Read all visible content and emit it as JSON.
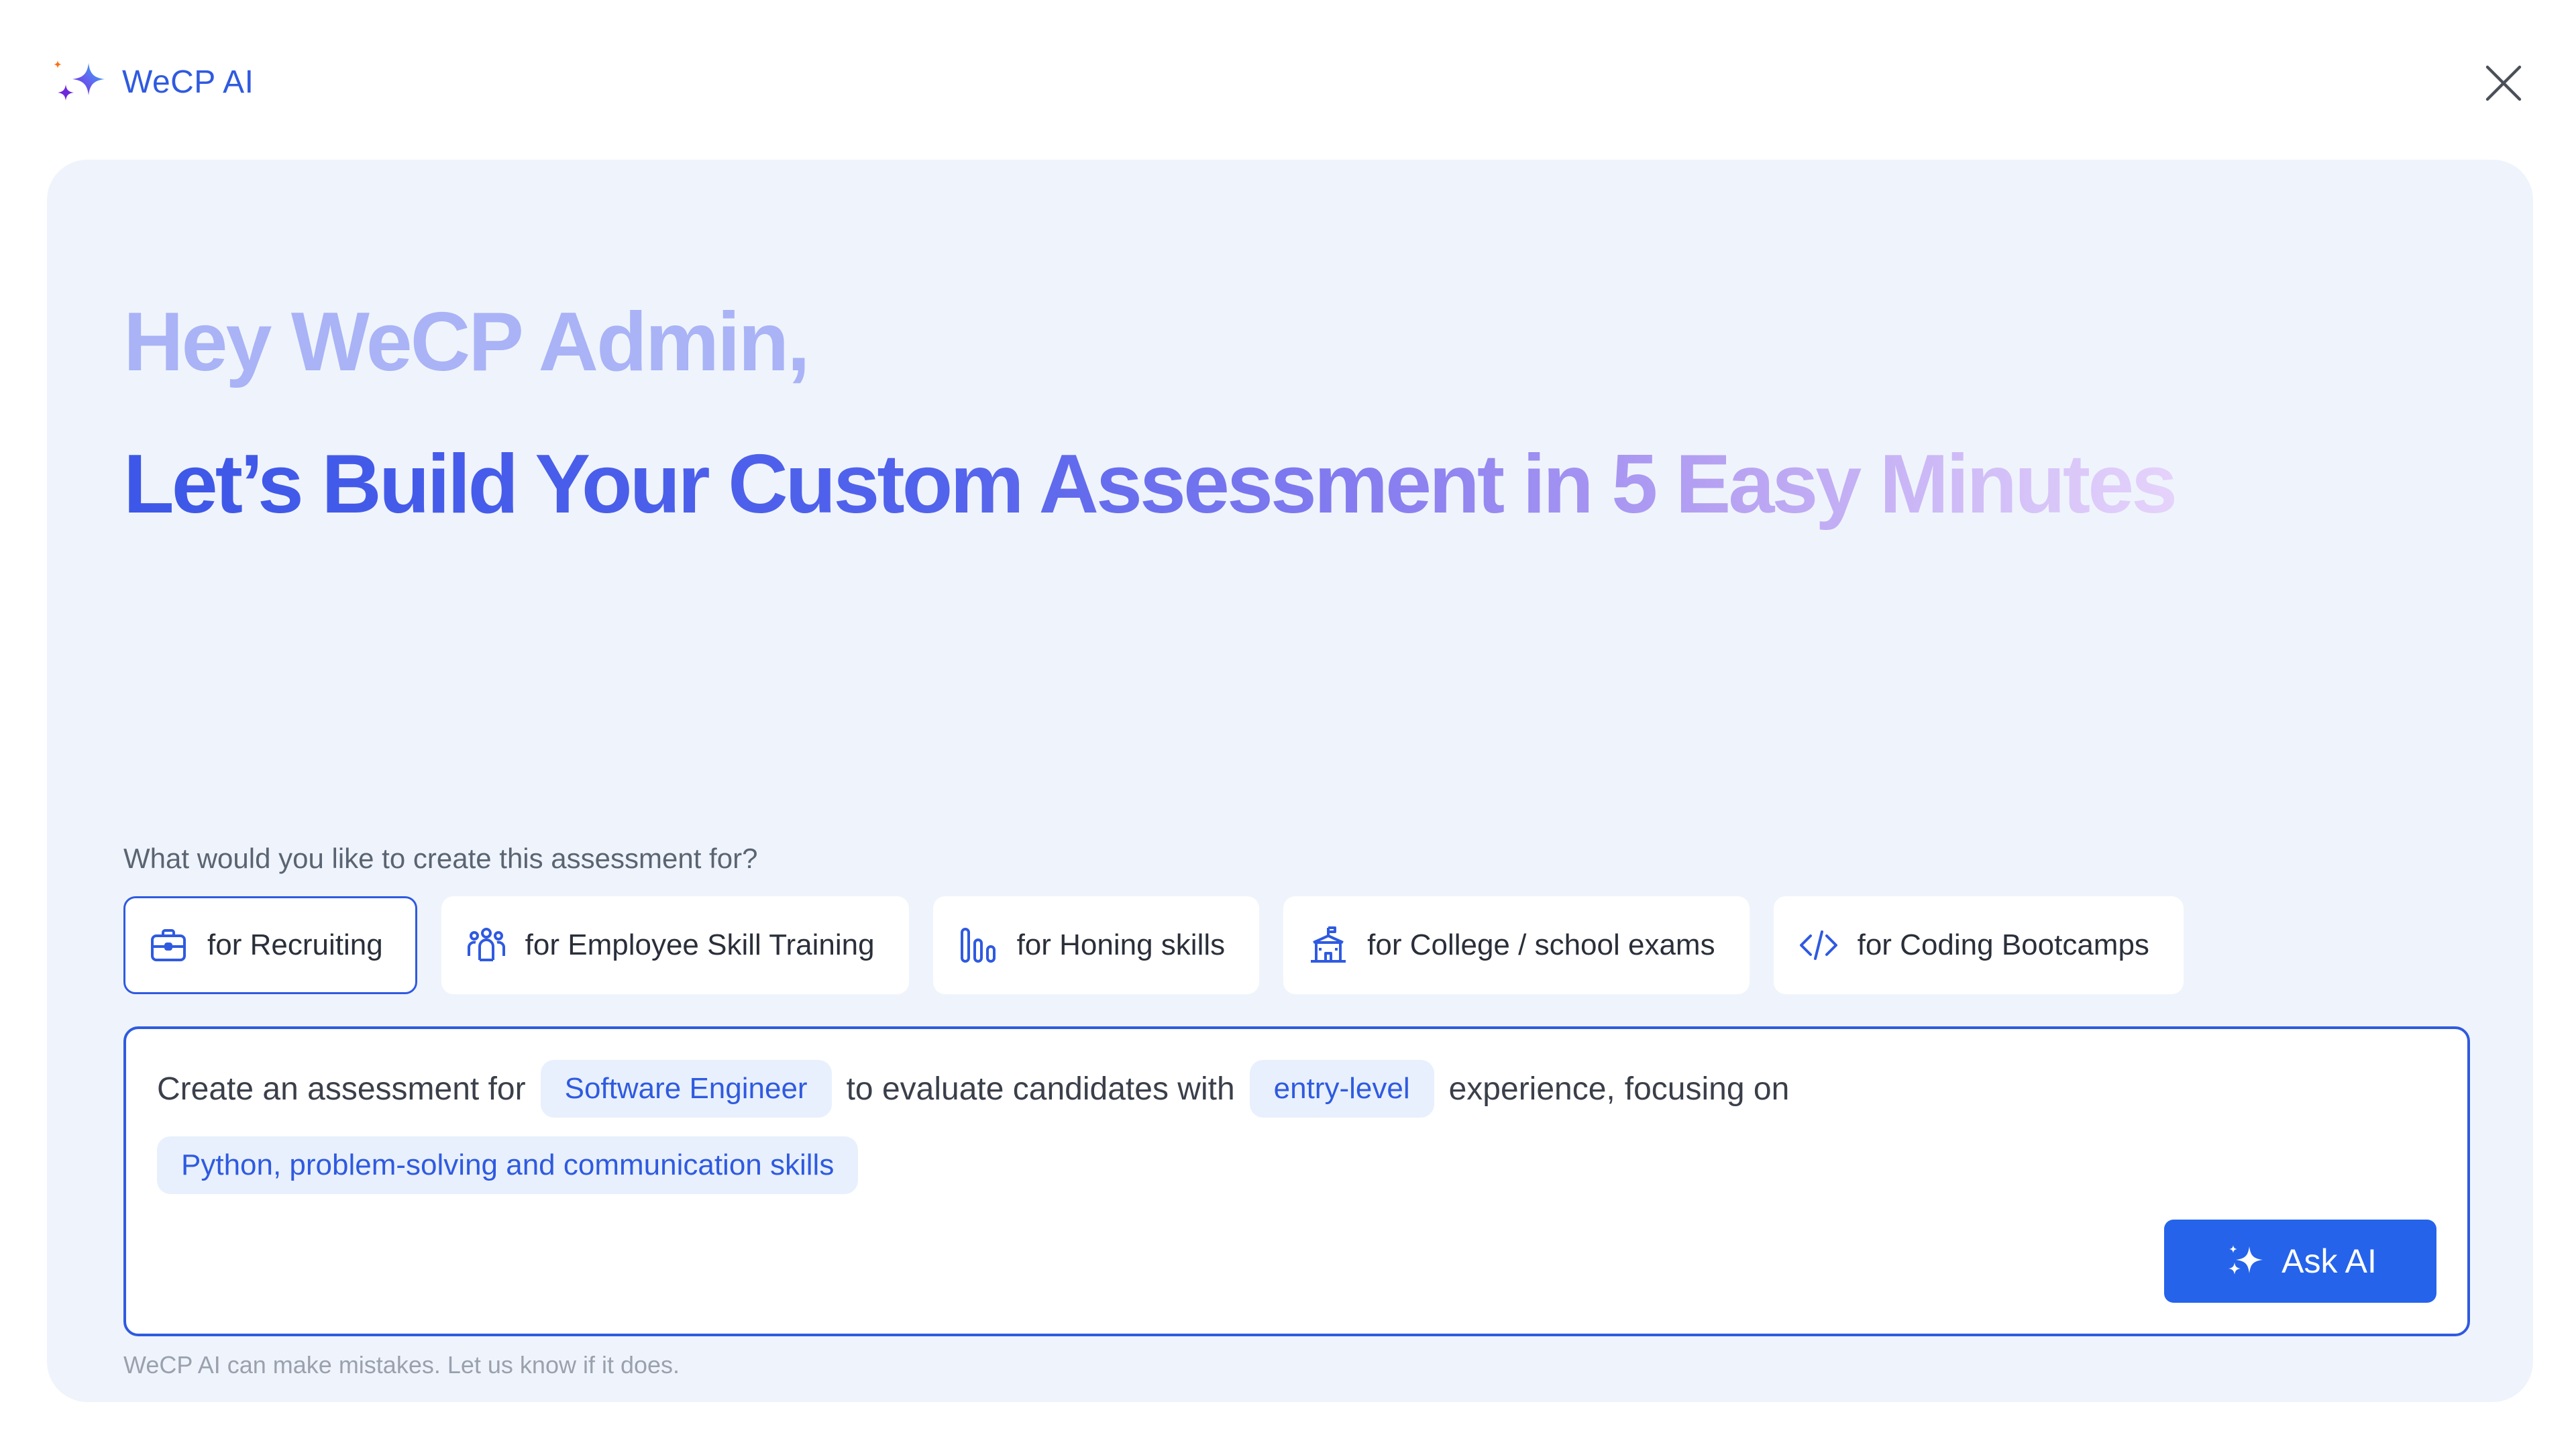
{
  "app": {
    "name": "WeCP AI",
    "logo_icon": "sparkles-icon",
    "close_icon": "close-icon"
  },
  "hero": {
    "greeting": "Hey WeCP Admin,",
    "headline": "Let’s Build Your Custom Assessment in 5 Easy Minutes"
  },
  "purpose": {
    "question": "What would you like to create this assessment for?",
    "options": [
      {
        "label": "for Recruiting",
        "icon": "briefcase-icon",
        "selected": true
      },
      {
        "label": "for Employee Skill Training",
        "icon": "team-icon",
        "selected": false
      },
      {
        "label": "for Honing skills",
        "icon": "bar-chart-icon",
        "selected": false
      },
      {
        "label": "for College / school exams",
        "icon": "school-icon",
        "selected": false
      },
      {
        "label": "for Coding Bootcamps",
        "icon": "code-icon",
        "selected": false
      }
    ]
  },
  "prompt": {
    "text_1": "Create an assessment for",
    "role": "Software Engineer",
    "text_2": "to evaluate candidates with",
    "experience": "entry-level",
    "text_3": "experience,",
    "text_4": "focusing on",
    "skills": "Python, problem-solving and communication skills",
    "ask_label": "Ask AI"
  },
  "disclaimer": "WeCP AI can make mistakes. Let us know if it does.",
  "colors": {
    "accent": "#2563eb",
    "brand_text": "#2f5ae0",
    "card_bg": "#eff4fc",
    "chip_bg": "#e8f0fd",
    "greeting": "#a9b3f6"
  }
}
